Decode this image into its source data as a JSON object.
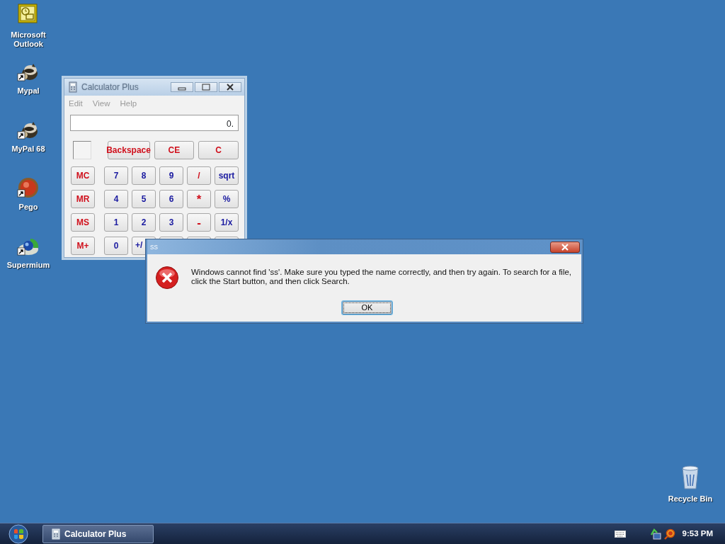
{
  "desktop_icons": [
    {
      "label": "Microsoft Outlook",
      "kind": "outlook",
      "shortcut": false
    },
    {
      "label": "Mypal",
      "kind": "animal",
      "shortcut": true
    },
    {
      "label": "MyPal 68",
      "kind": "animal",
      "shortcut": true
    },
    {
      "label": "Pego",
      "kind": "ball",
      "shortcut": true
    },
    {
      "label": "Supermium",
      "kind": "globe",
      "shortcut": true
    }
  ],
  "recycle_bin": {
    "label": "Recycle Bin"
  },
  "calculator": {
    "title": "Calculator Plus",
    "active": false,
    "menu": [
      "Edit",
      "View",
      "Help"
    ],
    "display": "0.",
    "top_keys": [
      {
        "label": "Backspace",
        "color": "#d0101c"
      },
      {
        "label": "CE",
        "color": "#d0101c"
      },
      {
        "label": "C",
        "color": "#d0101c"
      }
    ],
    "keys": [
      [
        {
          "label": "MC",
          "color": "#d0101c"
        },
        {
          "label": "7",
          "color": "#1a1aa0"
        },
        {
          "label": "8",
          "color": "#1a1aa0"
        },
        {
          "label": "9",
          "color": "#1a1aa0"
        },
        {
          "label": "/",
          "color": "#d0101c"
        },
        {
          "label": "sqrt",
          "color": "#1a1aa0"
        }
      ],
      [
        {
          "label": "MR",
          "color": "#d0101c"
        },
        {
          "label": "4",
          "color": "#1a1aa0"
        },
        {
          "label": "5",
          "color": "#1a1aa0"
        },
        {
          "label": "6",
          "color": "#1a1aa0"
        },
        {
          "label": "*",
          "color": "#d0101c"
        },
        {
          "label": "%",
          "color": "#1a1aa0"
        }
      ],
      [
        {
          "label": "MS",
          "color": "#d0101c"
        },
        {
          "label": "1",
          "color": "#1a1aa0"
        },
        {
          "label": "2",
          "color": "#1a1aa0"
        },
        {
          "label": "3",
          "color": "#1a1aa0"
        },
        {
          "label": "-",
          "color": "#d0101c"
        },
        {
          "label": "1/x",
          "color": "#1a1aa0"
        }
      ],
      [
        {
          "label": "M+",
          "color": "#d0101c"
        },
        {
          "label": "0",
          "color": "#1a1aa0"
        },
        {
          "label": "+/",
          "color": "#1a1aa0"
        }
      ]
    ]
  },
  "dialog": {
    "title": "ss",
    "message": "Windows cannot find 'ss'. Make sure you typed the name correctly, and then try again. To search for a file, click the Start button, and then click Search.",
    "buttons": [
      {
        "label": "OK",
        "focused": true
      }
    ]
  },
  "taskbar": {
    "tasks": [
      {
        "label": "Calculator Plus",
        "selected": false
      }
    ],
    "clock": "9:53 PM"
  }
}
